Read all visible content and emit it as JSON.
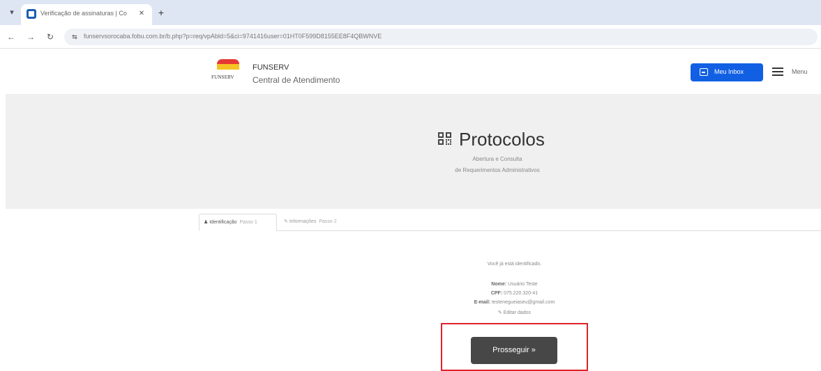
{
  "browser": {
    "tab_title": "Verificação de assinaturas | Co",
    "url": "funservsorocaba.fobu.com.br/b.php?p=req/vpAbld=5&ci=9741416user=01HT0F599D8155EE8F4QBWNVE"
  },
  "header": {
    "brand_name": "FUNSERV",
    "brand_sub": "Central de Atendimento",
    "logo_text": "FUNSERV",
    "inbox_label": "Meu Inbox",
    "menu_label": "Menu"
  },
  "hero": {
    "title": "Protocolos",
    "subtitle_1": "Abertura e Consulta",
    "subtitle_2": "de Requerimentos Administrativos"
  },
  "steps": [
    {
      "label": "Identificação",
      "sub": "Passo 1"
    },
    {
      "label": "Informações",
      "sub": "Passo 2"
    }
  ],
  "identification": {
    "intro": "Você já está identificado.",
    "name_label": "Nome:",
    "name_value": "Usuário Teste",
    "cpf_label": "CPF:",
    "cpf_value": "075.220.320-41",
    "email_label": "E-mail:",
    "email_value": "testenegueiaseu@gmail.com",
    "edit_label": "Editar dados"
  },
  "action": {
    "proceed_label": "Prosseguir »"
  },
  "colors": {
    "primary": "#1160e3",
    "proceed": "#474747",
    "highlight": "#e0212b"
  }
}
